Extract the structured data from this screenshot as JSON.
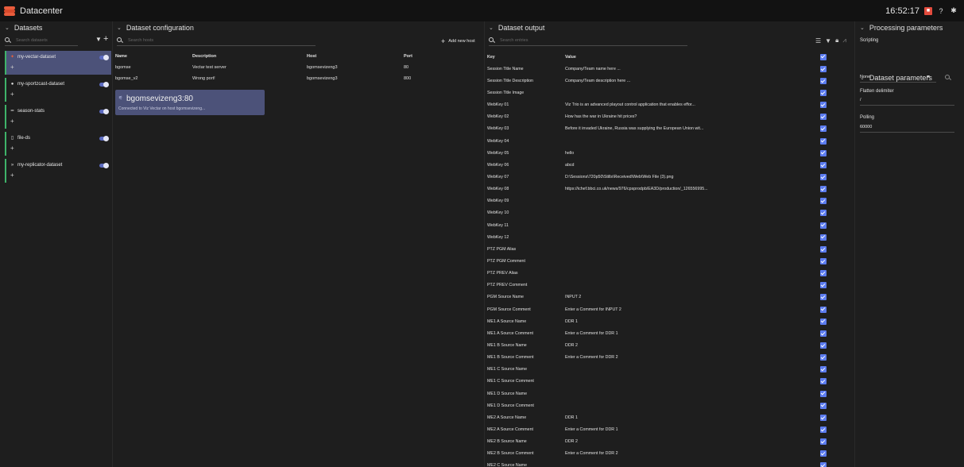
{
  "app": {
    "title": "Datacenter",
    "clock": "16:52:17"
  },
  "datasets": {
    "header": "Datasets",
    "search_placeholder": "Search datasets",
    "items": [
      {
        "name": "my-vectar-dataset",
        "icon": "vectar-icon",
        "active": true
      },
      {
        "name": "my-sportzcast-dataset",
        "icon": "info-icon"
      },
      {
        "name": "season-stats",
        "icon": "stats-icon"
      },
      {
        "name": "file-ds",
        "icon": "file-icon"
      },
      {
        "name": "my-replicator-dataset",
        "icon": "replicator-icon"
      }
    ]
  },
  "config": {
    "header": "Dataset configuration",
    "search_placeholder": "Search hosts",
    "add_label": "Add new host",
    "columns": [
      "Name",
      "Description",
      "Host",
      "Port"
    ],
    "rows": [
      [
        "bgomse",
        "Vectar test server",
        "bgomsevizeng3",
        "80"
      ],
      [
        "bgomse_v2",
        "Wrong port!",
        "bgomsevizeng3",
        "800"
      ]
    ],
    "card": {
      "title": "bgomsevizeng3:80",
      "subtitle": "Connected to Viz Vectar on host bgomsevizeng..."
    }
  },
  "output": {
    "header": "Dataset output",
    "search_placeholder": "Search entries",
    "columns": [
      "Key",
      "Value"
    ],
    "rows": [
      [
        "Session Title Name",
        "Company/Team name here ..."
      ],
      [
        "Session Title Description",
        "Company/Team description here ..."
      ],
      [
        "Session Title Image",
        ""
      ],
      [
        "WebKey 01",
        "Viz Trio is an advanced playout control application that enables effor..."
      ],
      [
        "WebKey 02",
        "How has the war in Ukraine hit prices?"
      ],
      [
        "WebKey 03",
        "Before it invaded Ukraine, Russia was supplying the European Union wit..."
      ],
      [
        "WebKey 04",
        ""
      ],
      [
        "WebKey 05",
        "hello"
      ],
      [
        "WebKey 06",
        "abcd"
      ],
      [
        "WebKey 07",
        "D:\\Sessions\\720p50\\Stills\\Received\\Web\\Web File (3).png"
      ],
      [
        "WebKey 08",
        "https://ichef.bbci.co.uk/news/976/cpsprodpb/EA3D/production/_126556995..."
      ],
      [
        "WebKey 09",
        ""
      ],
      [
        "WebKey 10",
        ""
      ],
      [
        "WebKey 11",
        ""
      ],
      [
        "WebKey 12",
        ""
      ],
      [
        "PTZ PGM Alias",
        ""
      ],
      [
        "PTZ PGM Comment",
        ""
      ],
      [
        "PTZ PREV Alias",
        ""
      ],
      [
        "PTZ PREV Comment",
        ""
      ],
      [
        "PGM Source Name",
        "INPUT 2"
      ],
      [
        "PGM Source Comment",
        "Enter a Comment for INPUT 2"
      ],
      [
        "ME1 A Source Name",
        "DDR 1"
      ],
      [
        "ME1 A Source Comment",
        "Enter a Comment for DDR 1"
      ],
      [
        "ME1 B Source Name",
        "DDR 2"
      ],
      [
        "ME1 B Source Comment",
        "Enter a Comment for DDR 2"
      ],
      [
        "ME1 C Source Name",
        ""
      ],
      [
        "ME1 C Source Comment",
        ""
      ],
      [
        "ME1 D Source Name",
        ""
      ],
      [
        "ME1 D Source Comment",
        ""
      ],
      [
        "ME2 A Source Name",
        "DDR 1"
      ],
      [
        "ME2 A Source Comment",
        "Enter a Comment for DDR 1"
      ],
      [
        "ME2 B Source Name",
        "DDR 2"
      ],
      [
        "ME2 B Source Comment",
        "Enter a Comment for DDR 2"
      ],
      [
        "ME2 C Source Name",
        ""
      ]
    ]
  },
  "processing": {
    "header": "Processing parameters",
    "scripting_label": "Scripting",
    "scripting_value": "None",
    "dataset_params_header": "Dataset parameters",
    "flatten_label": "Flatten delimiter",
    "flatten_value": "/",
    "polling_label": "Polling",
    "polling_value": "60000"
  },
  "colors": {
    "accent": "#5c6bc0",
    "active_item": "#4c5279",
    "enabled_bar": "#3fb36a",
    "brand": "#e85c3c"
  }
}
